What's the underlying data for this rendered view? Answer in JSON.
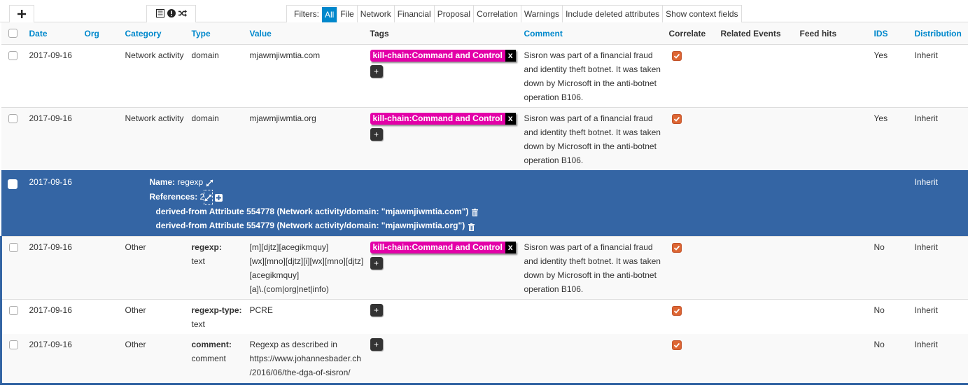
{
  "toolbar": {
    "add_label": "+",
    "icons": [
      "list-icon",
      "exclamation-circle-icon",
      "random-icon"
    ]
  },
  "filters": {
    "label": "Filters:",
    "items": [
      "All",
      "File",
      "Network",
      "Financial",
      "Proposal",
      "Correlation",
      "Warnings",
      "Include deleted attributes",
      "Show context fields"
    ],
    "active": "All"
  },
  "columns": {
    "date": "Date",
    "org": "Org",
    "category": "Category",
    "type": "Type",
    "value": "Value",
    "tags": "Tags",
    "comment": "Comment",
    "correlate": "Correlate",
    "related_events": "Related Events",
    "feed_hits": "Feed hits",
    "ids": "IDS",
    "distribution": "Distribution"
  },
  "rows": [
    {
      "date": "2017-09-16",
      "org": "",
      "category": "Network activity",
      "type": "domain",
      "value": "mjawmjiwmtia.com",
      "tag": "kill-chain:Command and Control",
      "tag_remove": "x",
      "comment": "Sisron was part of a financial fraud and identity theft botnet. It was taken down by Microsoft in the anti-botnet operation B106.",
      "correlate": true,
      "ids": "Yes",
      "distribution": "Inherit"
    },
    {
      "date": "2017-09-16",
      "org": "",
      "category": "Network activity",
      "type": "domain",
      "value": "mjawmjiwmtia.org",
      "tag": "kill-chain:Command and Control",
      "tag_remove": "x",
      "comment": "Sisron was part of a financial fraud and identity theft botnet. It was taken down by Microsoft in the anti-botnet operation B106.",
      "correlate": true,
      "ids": "Yes",
      "distribution": "Inherit"
    }
  ],
  "object": {
    "date": "2017-09-16",
    "name_label": "Name:",
    "name": "regexp",
    "references_label": "References:",
    "references_count": "2",
    "references": [
      "derived-from Attribute 554778 (Network activity/domain: \"mjawmjiwmtia.com\")",
      "derived-from Attribute 554779 (Network activity/domain: \"mjawmjiwmtia.org\")"
    ],
    "distribution": "Inherit",
    "attributes": [
      {
        "date": "2017-09-16",
        "category": "Other",
        "relation": "regexp:",
        "type": "text",
        "value": "[m][djtz][acegikmquy][wx][mno][djtz][i][wx][mno][djtz][acegikmquy][a]\\.(com|org|net|info)",
        "value_lines": [
          "[m][djtz][acegikmquy]",
          "[wx][mno][djtz][i][wx][mno][djtz]",
          "[acegikmquy]",
          "[a]\\.(com|org|net|info)"
        ],
        "tag": "kill-chain:Command and Control",
        "tag_remove": "x",
        "comment": "Sisron was part of a financial fraud and identity theft botnet. It was taken down by Microsoft in the anti-botnet operation B106.",
        "correlate": true,
        "ids": "No",
        "distribution": "Inherit"
      },
      {
        "date": "2017-09-16",
        "category": "Other",
        "relation": "regexp-type:",
        "type": "text",
        "value": "PCRE",
        "comment": "",
        "correlate": true,
        "ids": "No",
        "distribution": "Inherit"
      },
      {
        "date": "2017-09-16",
        "category": "Other",
        "relation": "comment:",
        "type": "comment",
        "value": "Regexp as described in https://www.johannesbader.ch/2016/06/the-dga-of-sisron/",
        "value_lines": [
          "Regexp as described in",
          "https://www.johannesbader.ch",
          "/2016/06/the-dga-of-sisron/"
        ],
        "comment": "",
        "correlate": true,
        "ids": "No",
        "distribution": "Inherit"
      }
    ]
  },
  "add_tag_label": "+",
  "colors": {
    "link_blue": "#0088cc",
    "object_row_bg": "#3465a4",
    "tag_bg": "#e300a8",
    "correlate_orange": "#dd6633"
  }
}
